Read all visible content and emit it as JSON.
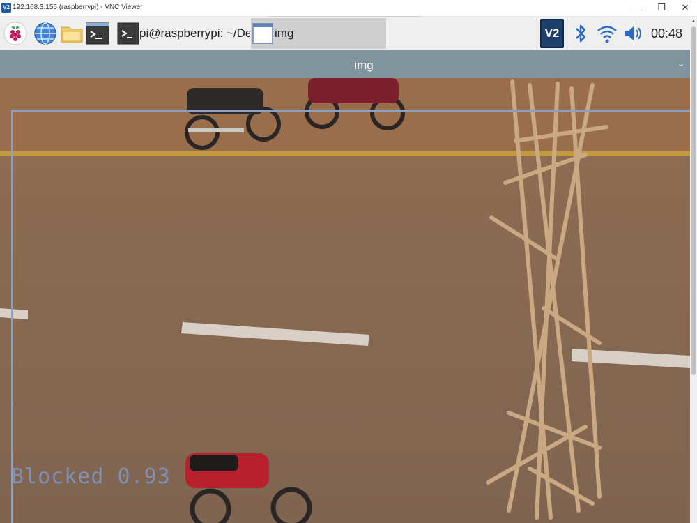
{
  "vnc_window": {
    "title": "192.168.3.155 (raspberrypi) - VNC Viewer",
    "logo_text": "V2",
    "minimize": "—",
    "maximize": "❐",
    "close": "✕"
  },
  "panel": {
    "launchers": [
      "raspberry-menu",
      "web-browser",
      "file-manager",
      "terminal"
    ],
    "tasks": [
      {
        "label": "pi@raspberrypi: ~/De...",
        "icon": "terminal-icon",
        "active": false
      },
      {
        "label": "img",
        "icon": "window-icon",
        "active": true
      }
    ],
    "tray": {
      "vnc_label": "V2",
      "clock": "00:48"
    }
  },
  "img_window": {
    "title": "img",
    "chevron": "⌄"
  },
  "detection": {
    "label": "Blocked 0.93",
    "class": "Blocked",
    "confidence": 0.93,
    "box_color": "#8da0c4"
  },
  "colors": {
    "panel_bg": "#efefef",
    "img_titlebar": "#7f949c",
    "road": "#8a6b52"
  }
}
